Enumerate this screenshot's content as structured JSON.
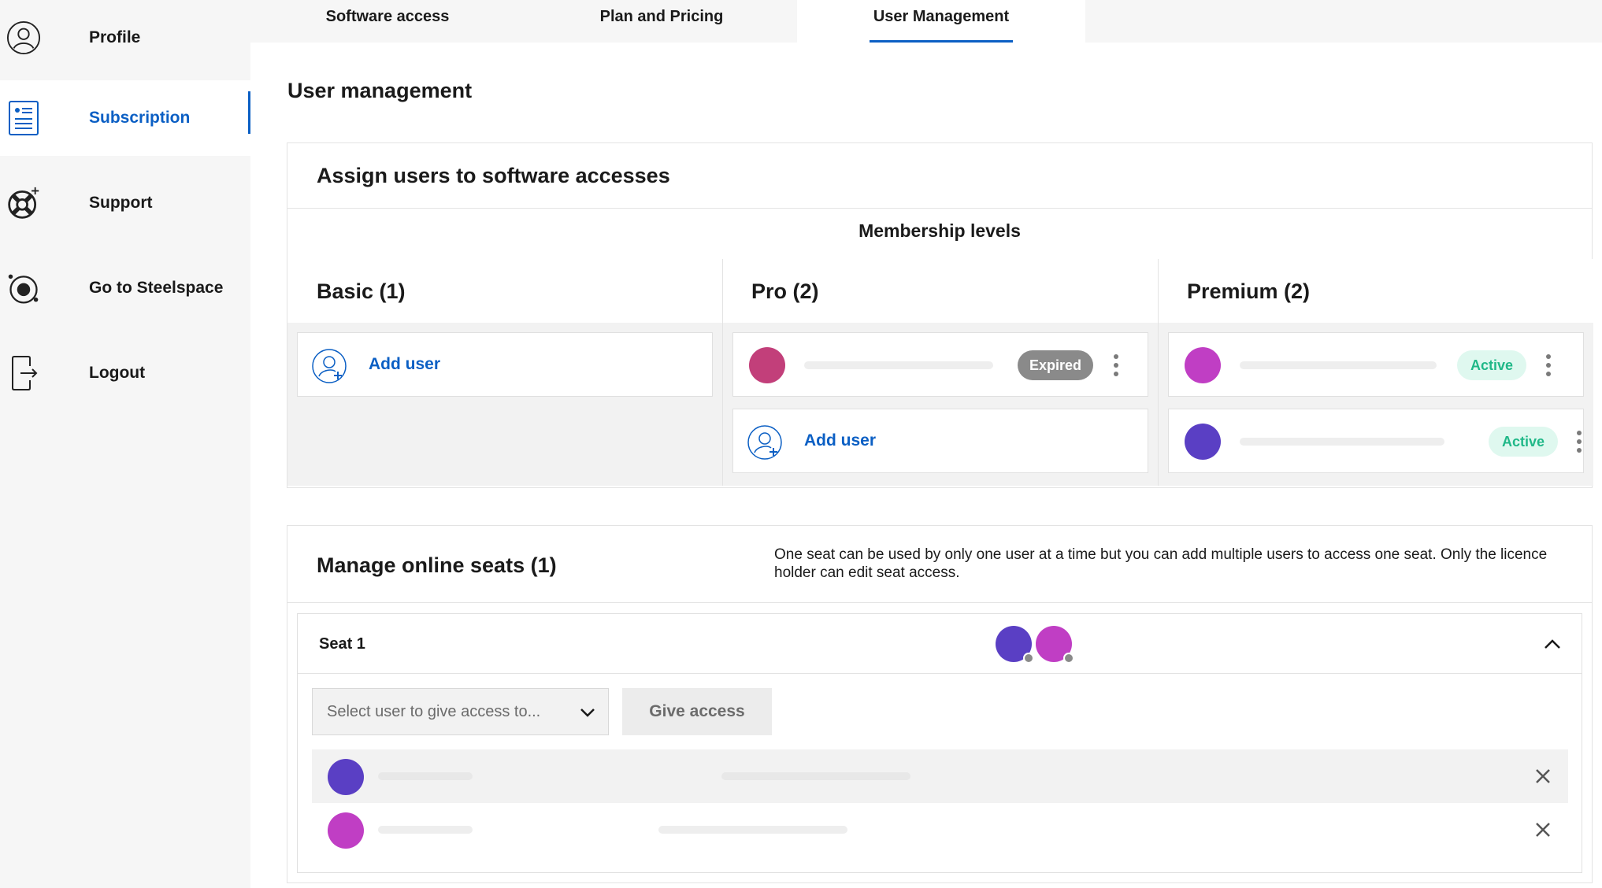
{
  "sidebar": {
    "items": [
      {
        "label": "Profile",
        "icon": "user-circle-icon"
      },
      {
        "label": "Subscription",
        "icon": "document-list-icon",
        "active": true
      },
      {
        "label": "Support",
        "icon": "lifebuoy-icon"
      },
      {
        "label": "Go to Steelspace",
        "icon": "orbit-icon"
      },
      {
        "label": "Logout",
        "icon": "logout-icon"
      }
    ]
  },
  "tabs": [
    {
      "label": "Software access"
    },
    {
      "label": "Plan and Pricing"
    },
    {
      "label": "User Management",
      "active": true
    }
  ],
  "main": {
    "title": "User management",
    "assign": {
      "title": "Assign users to software accesses",
      "membership_title": "Membership levels",
      "levels": [
        {
          "title": "Basic (1)",
          "add_user_label": "Add user"
        },
        {
          "title": "Pro (2)",
          "add_user_label": "Add user",
          "user_status": "Expired"
        },
        {
          "title": "Premium (2)",
          "user_statuses": [
            "Active",
            "Active"
          ]
        }
      ]
    },
    "seats": {
      "title": "Manage online seats (1)",
      "description": "One seat can be used by only one user at a time but you can add multiple users to access one seat. Only the licence holder can edit seat access.",
      "seat": {
        "title": "Seat 1",
        "select_placeholder": "Select user to give access to...",
        "give_access_label": "Give access"
      }
    }
  },
  "colors": {
    "accent": "#0b5fc4",
    "avatar_pink": "#c23f7a",
    "avatar_magenta": "#c03ec4",
    "avatar_indigo": "#5a3fc4",
    "status_active_bg": "#dff8ef",
    "status_active_text": "#20b888",
    "status_expired_bg": "#8a8a8a"
  }
}
